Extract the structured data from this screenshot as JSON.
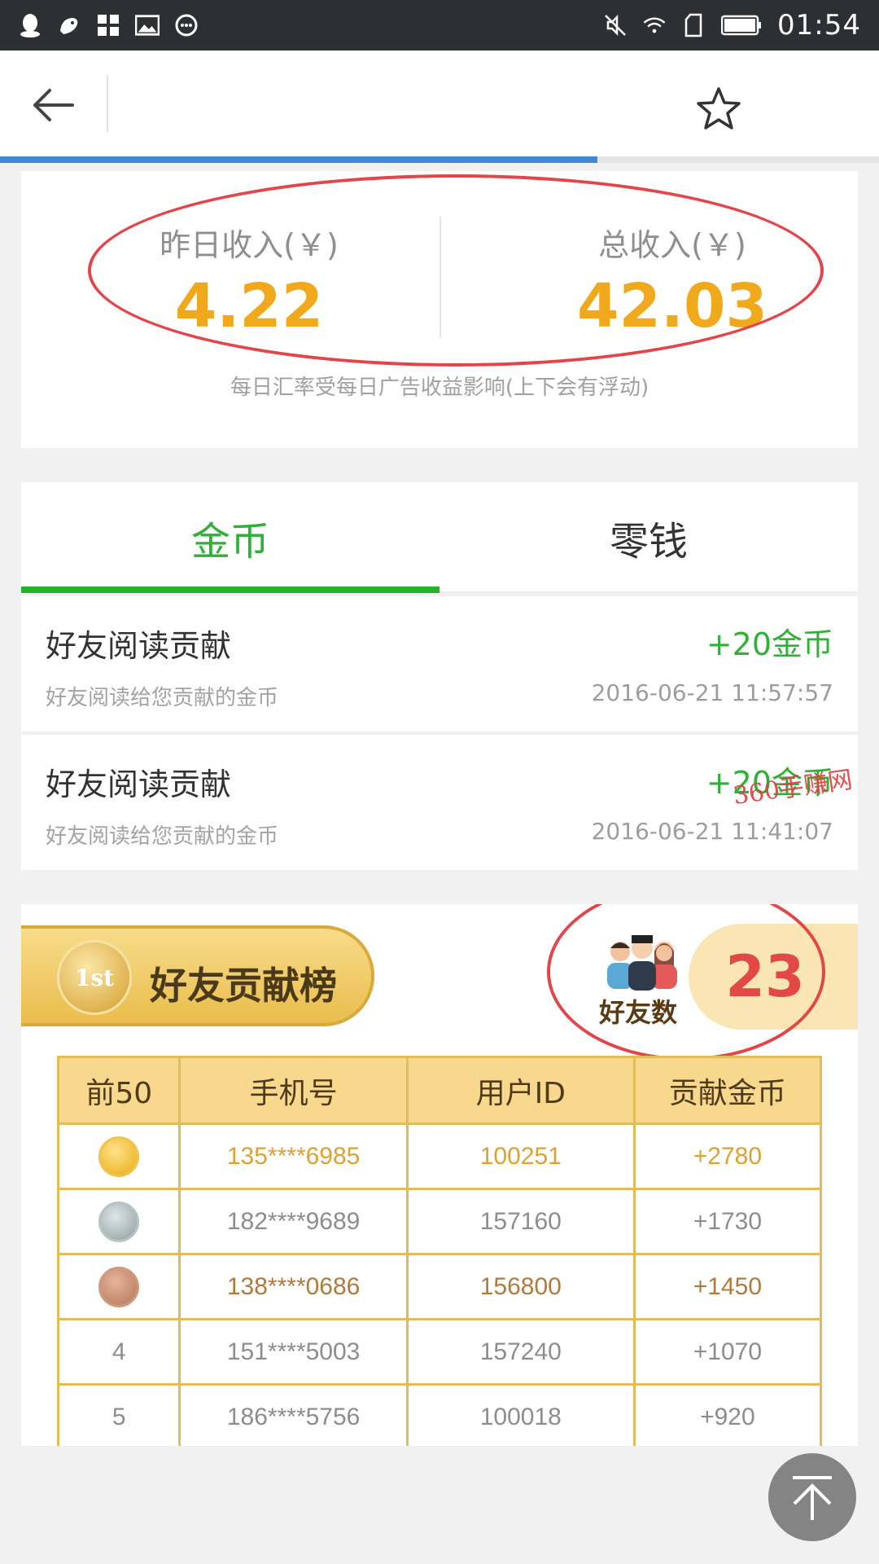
{
  "status_bar": {
    "time": "01:54",
    "left_icons": [
      "qq-icon",
      "uc-browser-icon",
      "app-grid-icon",
      "image-icon",
      "chat-bubble-icon"
    ],
    "right_icons": [
      "mute-icon",
      "wifi-icon",
      "sim-icon",
      "battery-icon"
    ]
  },
  "app_bar": {
    "back_icon": "back-arrow-icon",
    "favorite_icon": "star-icon",
    "page_load_progress": 0.68
  },
  "income": {
    "yesterday_label": "昨日收入(￥)",
    "yesterday_value": "4.22",
    "total_label": "总收入(￥)",
    "total_value": "42.03",
    "note": "每日汇率受每日广告收益影响(上下会有浮动)"
  },
  "tabs": [
    {
      "label": "金币",
      "active": true
    },
    {
      "label": "零钱",
      "active": false
    }
  ],
  "records": [
    {
      "title": "好友阅读贡献",
      "amount": "+20金币",
      "desc": "好友阅读给您贡献的金币",
      "time": "2016-06-21 11:57:57"
    },
    {
      "title": "好友阅读贡献",
      "amount": "+20金币",
      "desc": "好友阅读给您贡献的金币",
      "time": "2016-06-21 11:41:07"
    }
  ],
  "watermark": "360手赚网",
  "leaderboard": {
    "title": "好友贡献榜",
    "medal_text": "1st",
    "friends_label": "好友数",
    "friends_count": "23",
    "headers": [
      "前50",
      "手机号",
      "用户ID",
      "贡献金币"
    ],
    "rows": [
      {
        "rank": "1",
        "phone": "135****6985",
        "uid": "100251",
        "coins": "+2780"
      },
      {
        "rank": "2",
        "phone": "182****9689",
        "uid": "157160",
        "coins": "+1730"
      },
      {
        "rank": "3",
        "phone": "138****0686",
        "uid": "156800",
        "coins": "+1450"
      },
      {
        "rank": "4",
        "phone": "151****5003",
        "uid": "157240",
        "coins": "+1070"
      },
      {
        "rank": "5",
        "phone": "186****5756",
        "uid": "100018",
        "coins": "+920"
      }
    ]
  },
  "colors": {
    "accent_green": "#22b52a",
    "income_orange": "#f0a81c",
    "highlight_red": "#e2464a",
    "board_gold": "#f7d88d"
  },
  "scroll_top_icon": "scroll-to-top-icon"
}
